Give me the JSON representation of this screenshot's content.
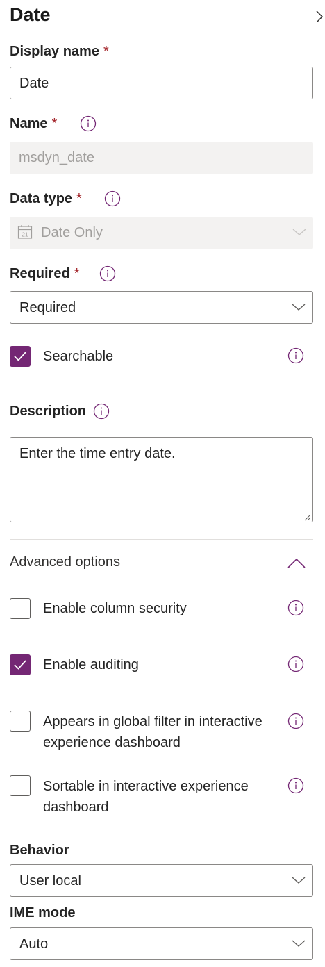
{
  "panel": {
    "title": "Date"
  },
  "display_name": {
    "label": "Display name",
    "required_mark": "*",
    "value": "Date"
  },
  "name": {
    "label": "Name",
    "required_mark": "*",
    "value": "msdyn_date"
  },
  "data_type": {
    "label": "Data type",
    "required_mark": "*",
    "value": "Date Only",
    "calendar_number": "21"
  },
  "required": {
    "label": "Required",
    "required_mark": "*",
    "value": "Required"
  },
  "searchable": {
    "label": "Searchable",
    "checked": true
  },
  "description": {
    "label": "Description",
    "value": "Enter the time entry date."
  },
  "advanced": {
    "label": "Advanced options",
    "expanded": true,
    "options": [
      {
        "label": "Enable column security",
        "checked": false
      },
      {
        "label": "Enable auditing",
        "checked": true
      },
      {
        "label_line1": "Appears in global filter in interactive",
        "label_line2": "experience dashboard",
        "checked": false
      },
      {
        "label_line1": "Sortable in interactive experience",
        "label_line2": "dashboard",
        "checked": false
      }
    ]
  },
  "behavior": {
    "label": "Behavior",
    "value": "User local"
  },
  "ime_mode": {
    "label": "IME mode",
    "value": "Auto"
  },
  "colors": {
    "accent": "#742774",
    "required_star": "#a4262c",
    "disabled_bg": "#f3f2f1",
    "border": "#8a8886"
  }
}
